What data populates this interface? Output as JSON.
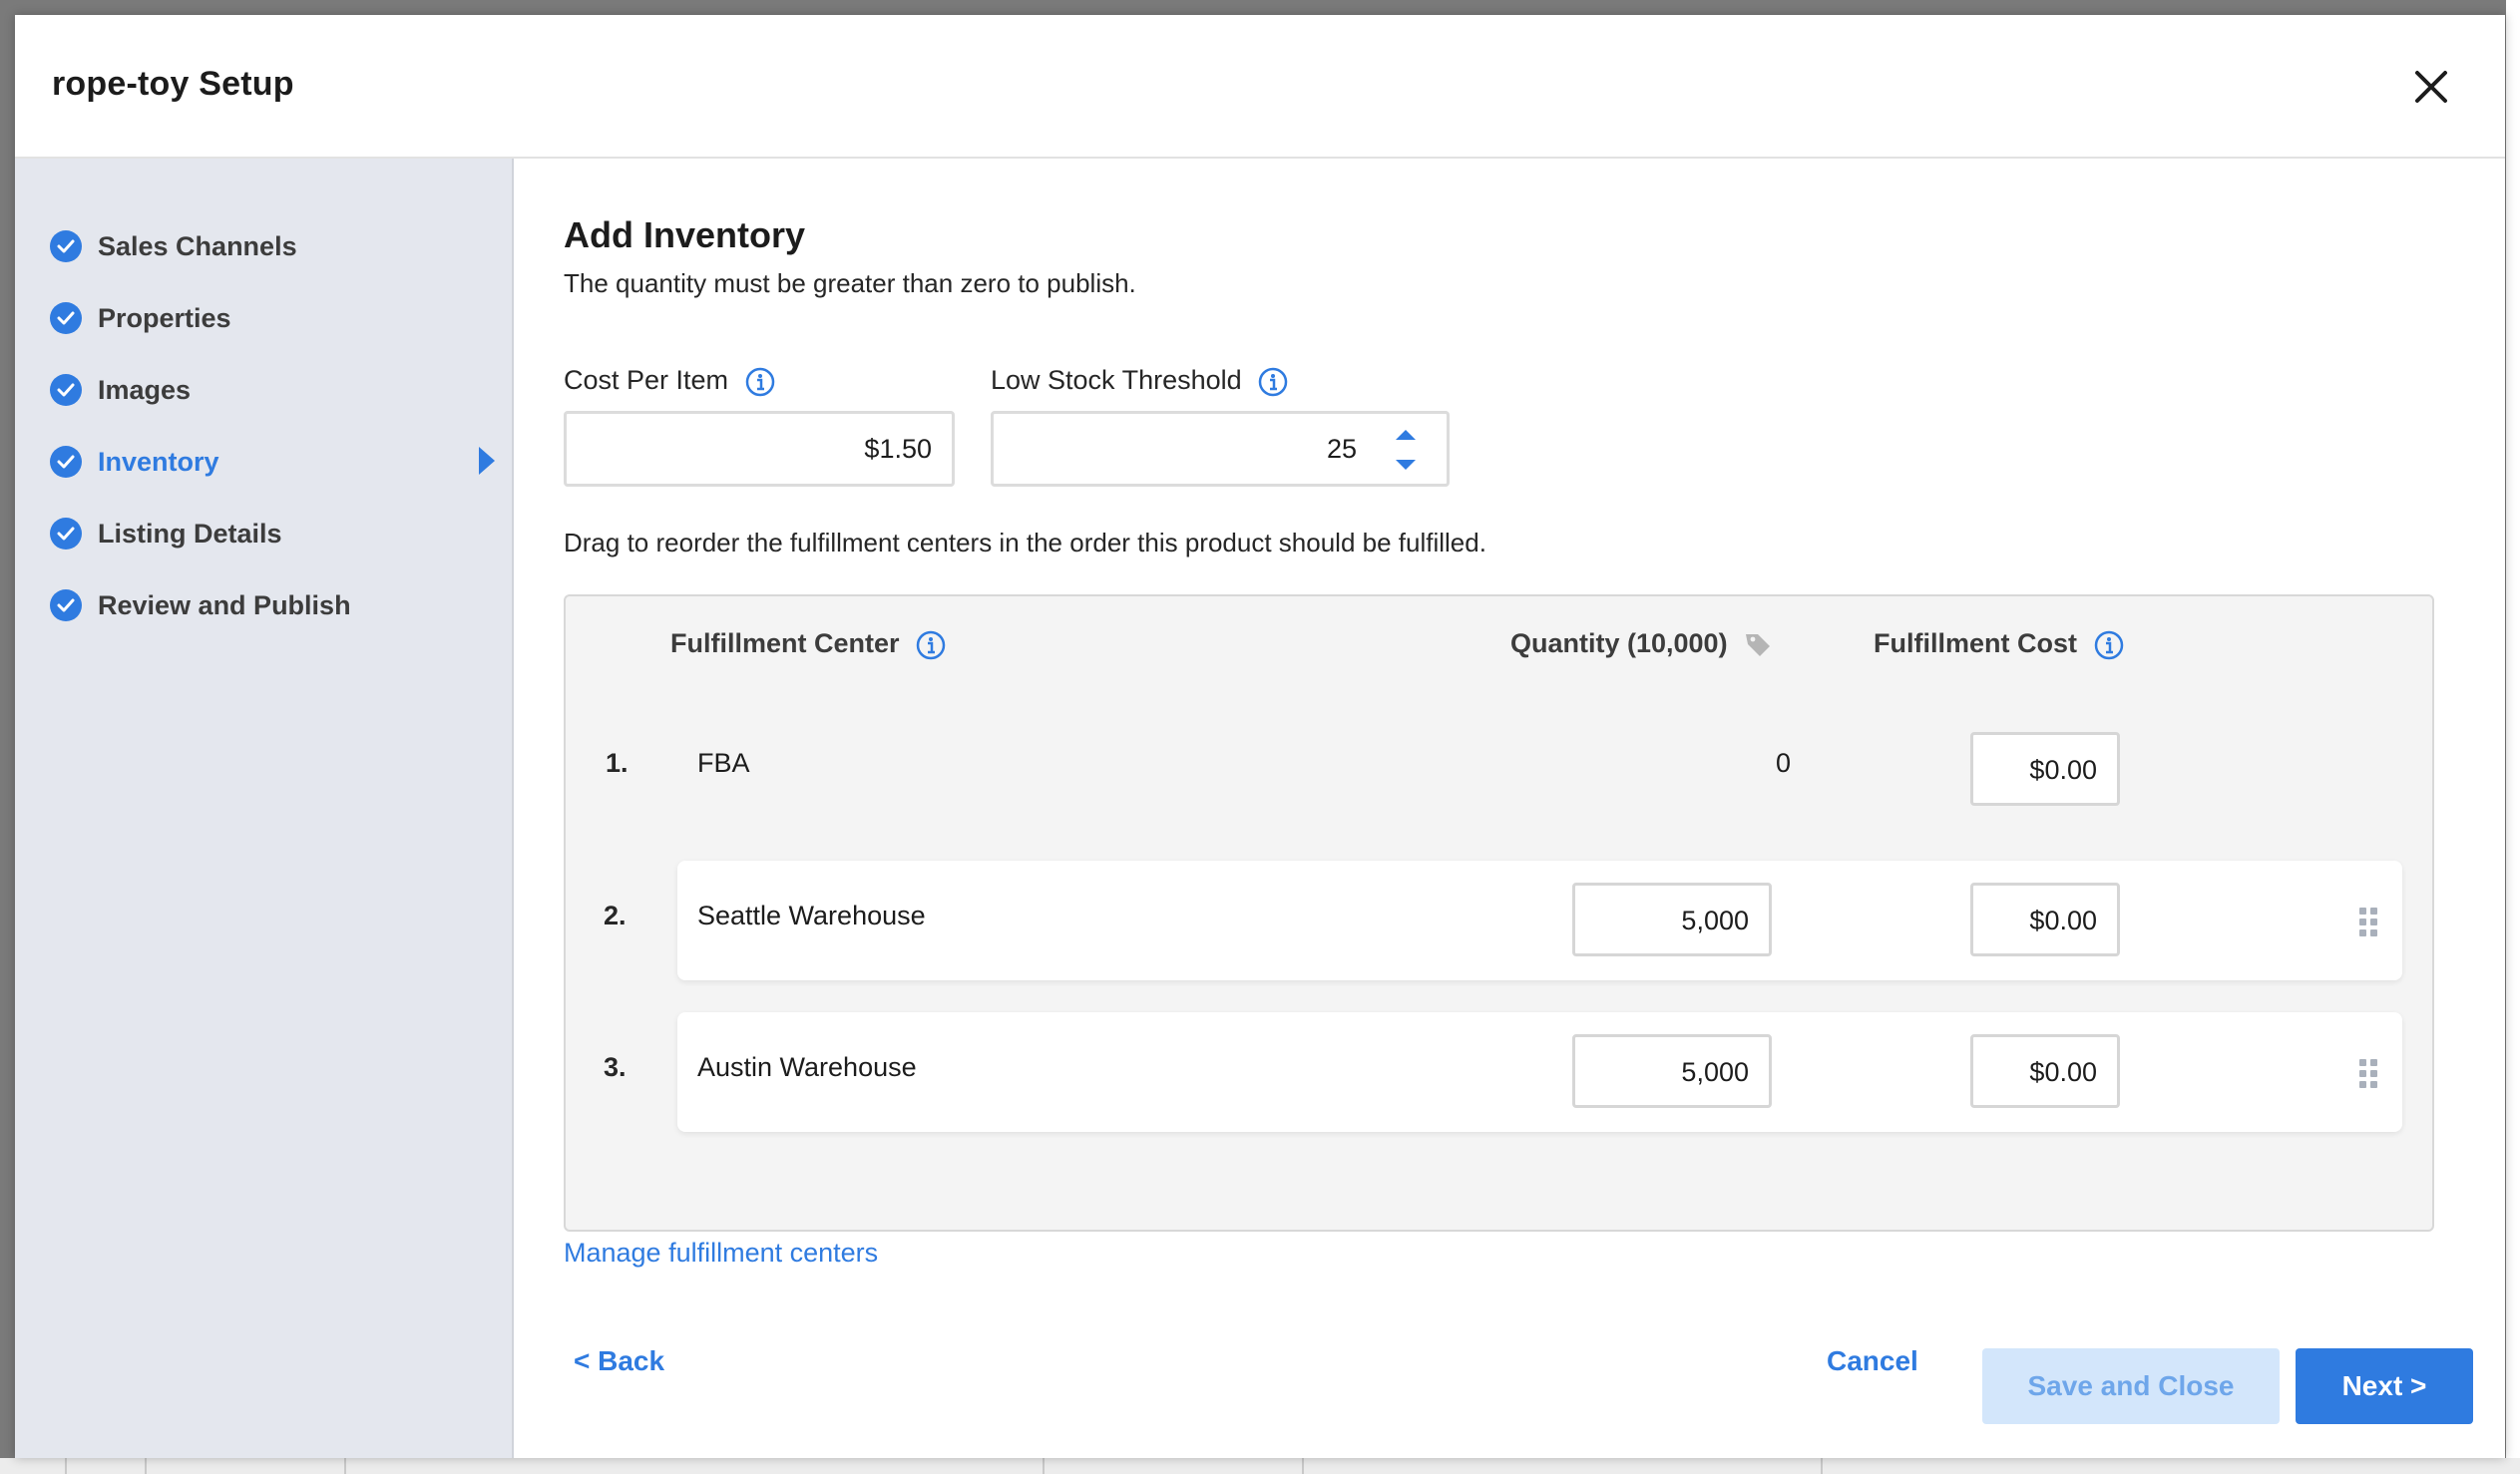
{
  "modal": {
    "title": "rope-toy Setup"
  },
  "sidebar": {
    "steps": [
      {
        "label": "Sales Channels",
        "done": true
      },
      {
        "label": "Properties",
        "done": true
      },
      {
        "label": "Images",
        "done": true
      },
      {
        "label": "Inventory",
        "done": true,
        "active": true
      },
      {
        "label": "Listing Details",
        "done": true
      },
      {
        "label": "Review and Publish",
        "done": true
      }
    ]
  },
  "main": {
    "heading": "Add Inventory",
    "subtitle": "The quantity must be greater than zero to publish.",
    "cost_per_item": {
      "label": "Cost Per Item",
      "value": "$1.50"
    },
    "low_stock": {
      "label": "Low Stock Threshold",
      "value": "25"
    },
    "drag_note": "Drag to reorder the fulfillment centers in the order this product should be fulfilled.",
    "table": {
      "headers": {
        "center": "Fulfillment Center",
        "quantity": "Quantity (10,000)",
        "cost": "Fulfillment Cost"
      },
      "rows": [
        {
          "num": "1.",
          "name": "FBA",
          "quantity": "0",
          "cost": "$0.00"
        },
        {
          "num": "2.",
          "name": "Seattle Warehouse",
          "quantity": "5,000",
          "cost": "$0.00"
        },
        {
          "num": "3.",
          "name": "Austin Warehouse",
          "quantity": "5,000",
          "cost": "$0.00"
        }
      ]
    },
    "manage_link": "Manage fulfillment centers"
  },
  "footer": {
    "back": "< Back",
    "cancel": "Cancel",
    "save_close": "Save and Close",
    "next": "Next >"
  },
  "colors": {
    "accent": "#2f7be0",
    "sidebar_bg": "#e4e7ee",
    "table_bg": "#f4f4f4",
    "save_bg": "#d3e6fb"
  }
}
